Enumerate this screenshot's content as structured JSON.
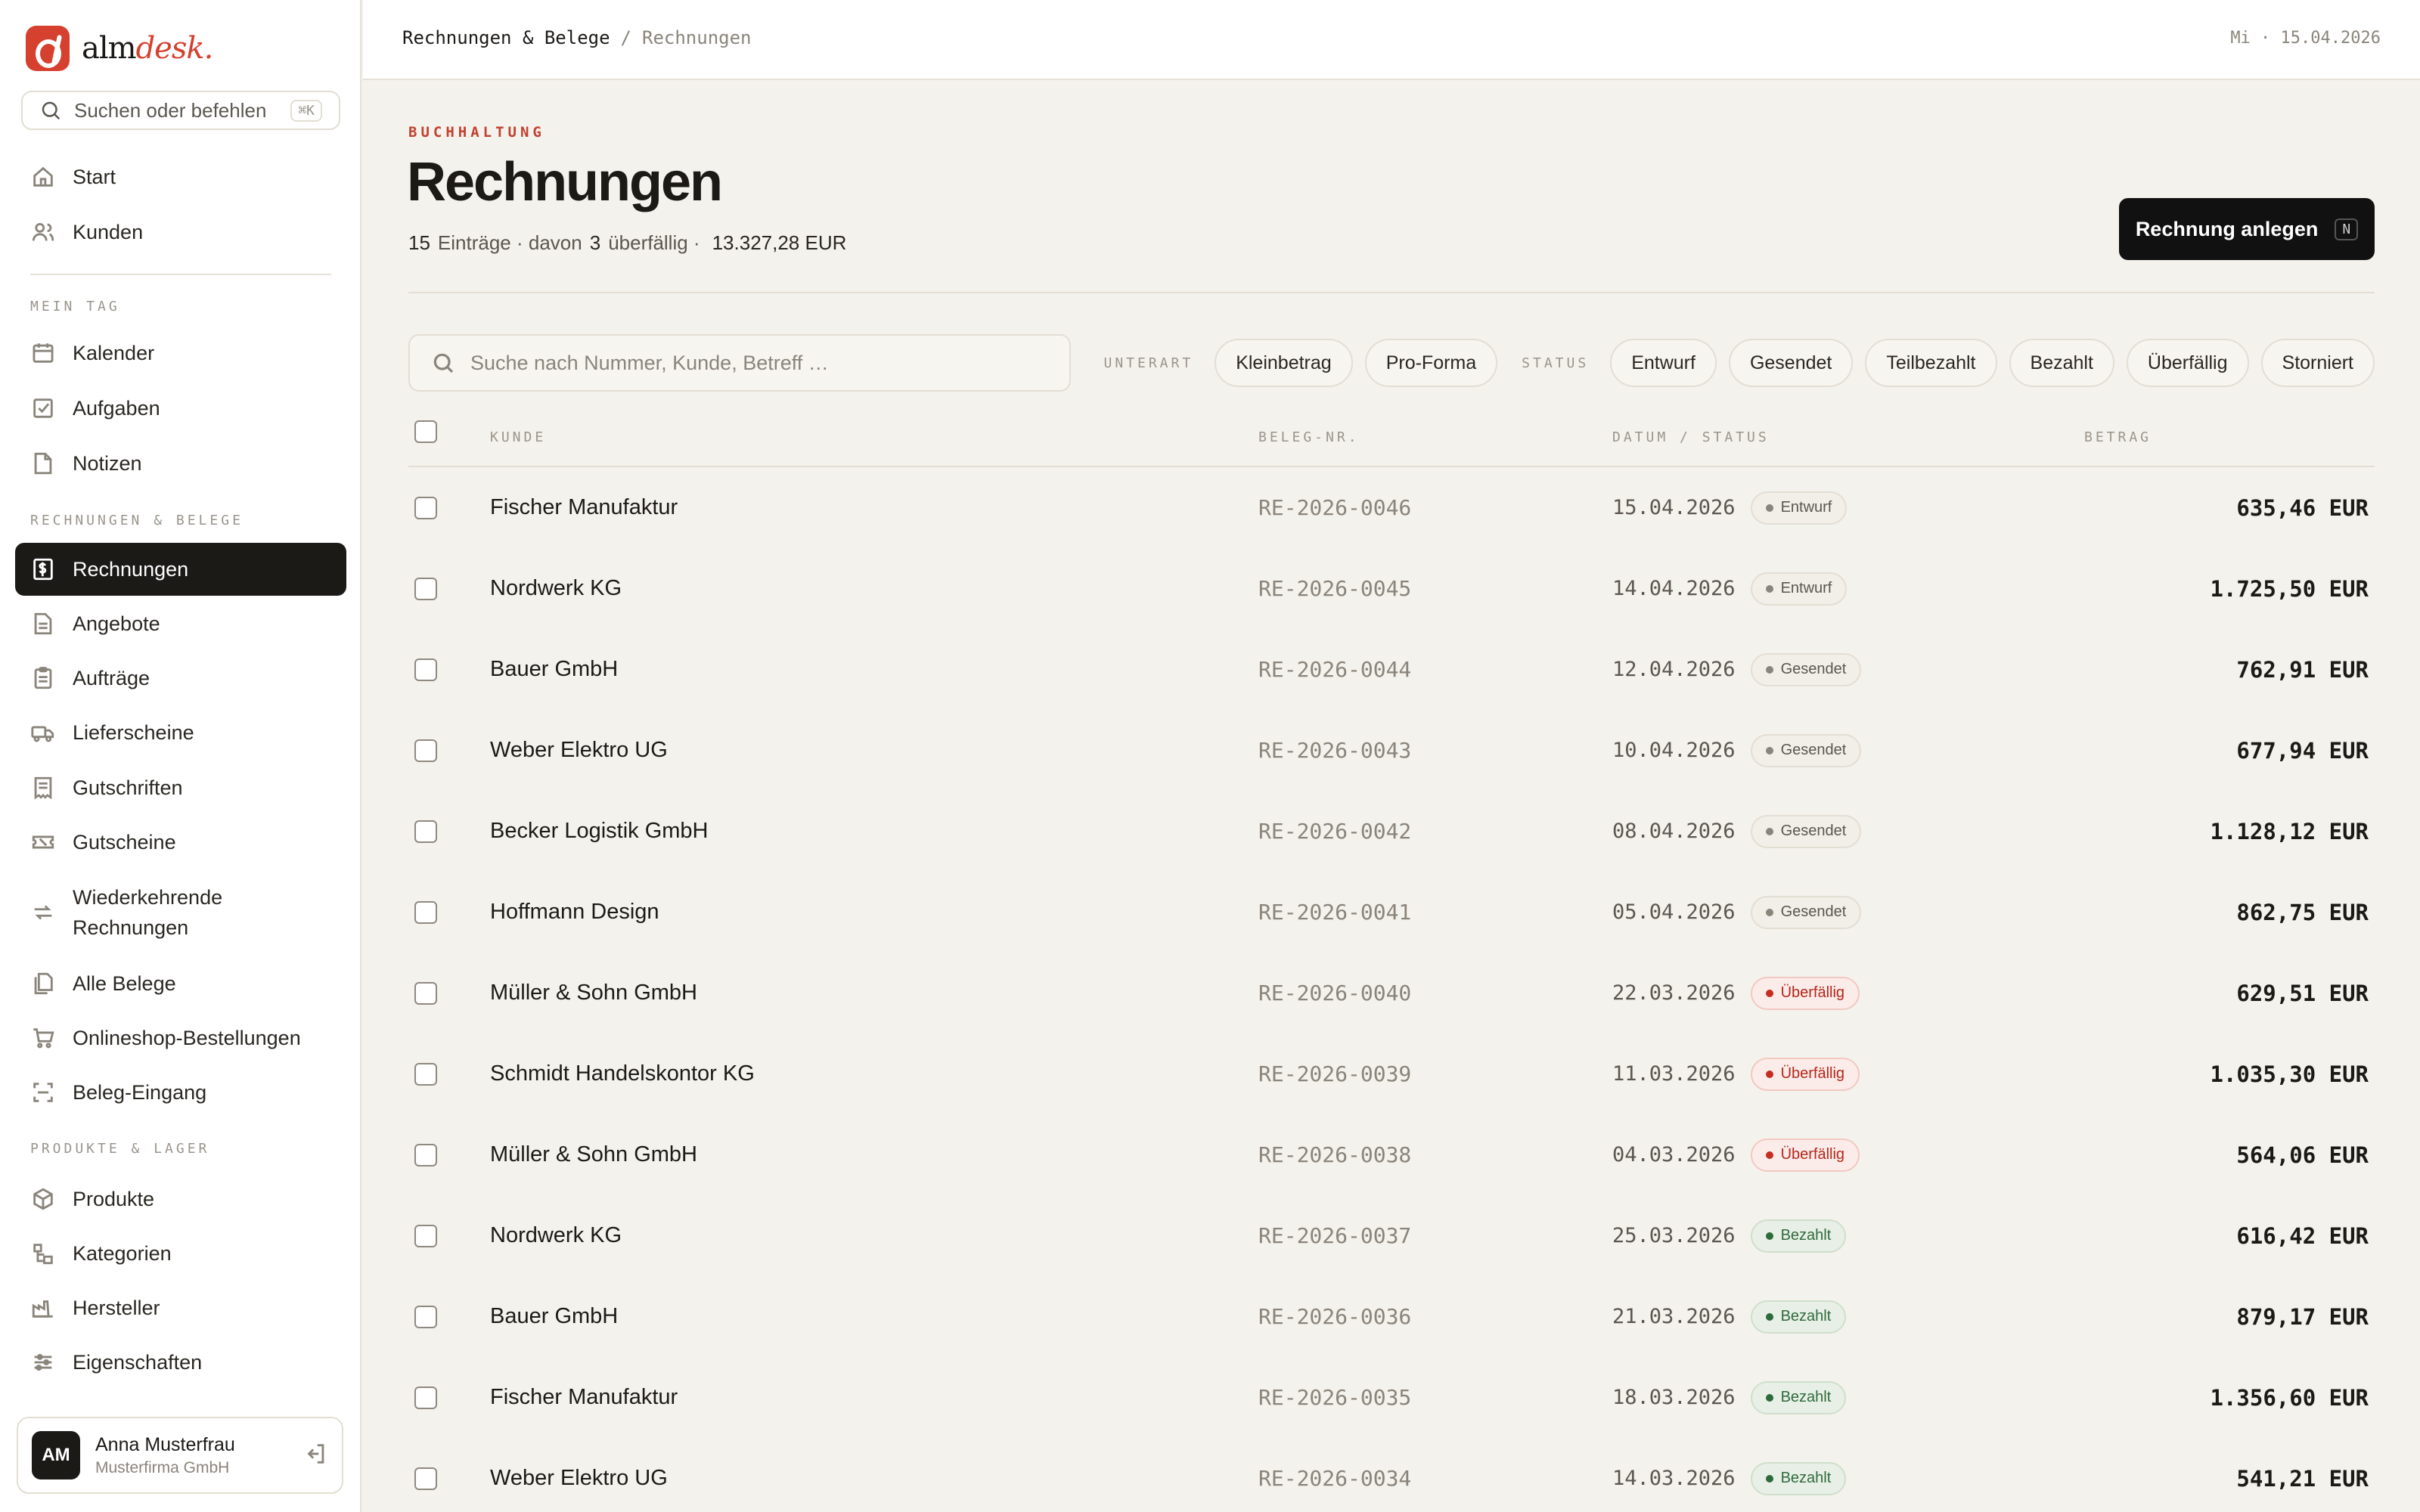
{
  "app": {
    "logo_main": "alm",
    "logo_accent": "desk."
  },
  "sidebar": {
    "search_placeholder": "Suchen oder befehlen",
    "search_shortcut": "⌘K",
    "top_items": [
      {
        "label": "Start",
        "icon": "home-icon"
      },
      {
        "label": "Kunden",
        "icon": "users-icon"
      }
    ],
    "sections": {
      "mein_tag": "MEIN TAG",
      "rechnungen": "RECHNUNGEN & BELEGE",
      "produkte": "PRODUKTE & LAGER"
    },
    "mein_tag_items": [
      {
        "label": "Kalender",
        "icon": "calendar-icon"
      },
      {
        "label": "Aufgaben",
        "icon": "checkbox-icon"
      },
      {
        "label": "Notizen",
        "icon": "note-icon"
      }
    ],
    "rechnungen_items": [
      {
        "label": "Rechnungen",
        "icon": "invoice-icon",
        "active": true
      },
      {
        "label": "Angebote",
        "icon": "document-icon"
      },
      {
        "label": "Aufträge",
        "icon": "clipboard-icon"
      },
      {
        "label": "Lieferscheine",
        "icon": "truck-icon"
      },
      {
        "label": "Gutschriften",
        "icon": "receipt-icon"
      },
      {
        "label": "Gutscheine",
        "icon": "ticket-icon"
      },
      {
        "label": "Wiederkehrende Rechnungen",
        "icon": "repeat-icon"
      },
      {
        "label": "Alle Belege",
        "icon": "files-icon"
      },
      {
        "label": "Onlineshop-Bestellungen",
        "icon": "cart-icon"
      },
      {
        "label": "Beleg-Eingang",
        "icon": "scan-icon"
      }
    ],
    "produkte_items": [
      {
        "label": "Produkte",
        "icon": "box-icon"
      },
      {
        "label": "Kategorien",
        "icon": "category-icon"
      },
      {
        "label": "Hersteller",
        "icon": "factory-icon"
      },
      {
        "label": "Eigenschaften",
        "icon": "sliders-icon"
      }
    ],
    "user": {
      "initials": "AM",
      "name": "Anna Musterfrau",
      "company": "Musterfirma GmbH"
    }
  },
  "topbar": {
    "breadcrumb_parent": "Rechnungen & Belege",
    "breadcrumb_sep": "/",
    "breadcrumb_current": "Rechnungen",
    "date": "Mi · 15.04.2026"
  },
  "page": {
    "eyebrow": "BUCHHALTUNG",
    "title": "Rechnungen",
    "summary": {
      "count": "15",
      "count_label": "Einträge · davon",
      "overdue": "3",
      "overdue_label": "überfällig ·",
      "total": "13.327,28 EUR"
    },
    "create_button": "Rechnung anlegen",
    "create_shortcut": "N"
  },
  "filters": {
    "search_placeholder": "Suche nach Nummer, Kunde, Betreff …",
    "unterart_label": "UNTERART",
    "unterart": [
      "Kleinbetrag",
      "Pro-Forma"
    ],
    "status_label": "STATUS",
    "status": [
      "Entwurf",
      "Gesendet",
      "Teilbezahlt",
      "Bezahlt",
      "Überfällig",
      "Storniert"
    ]
  },
  "table": {
    "columns": {
      "kunde": "KUNDE",
      "beleg": "BELEG-NR.",
      "datum": "DATUM / STATUS",
      "betrag": "BETRAG"
    },
    "rows": [
      {
        "kunde": "Fischer Manufaktur",
        "nr": "RE-2026-0046",
        "datum": "15.04.2026",
        "status": "Entwurf",
        "kind": "draft",
        "betrag": "635,46 EUR"
      },
      {
        "kunde": "Nordwerk KG",
        "nr": "RE-2026-0045",
        "datum": "14.04.2026",
        "status": "Entwurf",
        "kind": "draft",
        "betrag": "1.725,50 EUR"
      },
      {
        "kunde": "Bauer GmbH",
        "nr": "RE-2026-0044",
        "datum": "12.04.2026",
        "status": "Gesendet",
        "kind": "sent",
        "betrag": "762,91 EUR"
      },
      {
        "kunde": "Weber Elektro UG",
        "nr": "RE-2026-0043",
        "datum": "10.04.2026",
        "status": "Gesendet",
        "kind": "sent",
        "betrag": "677,94 EUR"
      },
      {
        "kunde": "Becker Logistik GmbH",
        "nr": "RE-2026-0042",
        "datum": "08.04.2026",
        "status": "Gesendet",
        "kind": "sent",
        "betrag": "1.128,12 EUR"
      },
      {
        "kunde": "Hoffmann Design",
        "nr": "RE-2026-0041",
        "datum": "05.04.2026",
        "status": "Gesendet",
        "kind": "sent",
        "betrag": "862,75 EUR"
      },
      {
        "kunde": "Müller & Sohn GmbH",
        "nr": "RE-2026-0040",
        "datum": "22.03.2026",
        "status": "Überfällig",
        "kind": "overdue",
        "betrag": "629,51 EUR"
      },
      {
        "kunde": "Schmidt Handelskontor KG",
        "nr": "RE-2026-0039",
        "datum": "11.03.2026",
        "status": "Überfällig",
        "kind": "overdue",
        "betrag": "1.035,30 EUR"
      },
      {
        "kunde": "Müller & Sohn GmbH",
        "nr": "RE-2026-0038",
        "datum": "04.03.2026",
        "status": "Überfällig",
        "kind": "overdue",
        "betrag": "564,06 EUR"
      },
      {
        "kunde": "Nordwerk KG",
        "nr": "RE-2026-0037",
        "datum": "25.03.2026",
        "status": "Bezahlt",
        "kind": "paid",
        "betrag": "616,42 EUR"
      },
      {
        "kunde": "Bauer GmbH",
        "nr": "RE-2026-0036",
        "datum": "21.03.2026",
        "status": "Bezahlt",
        "kind": "paid",
        "betrag": "879,17 EUR"
      },
      {
        "kunde": "Fischer Manufaktur",
        "nr": "RE-2026-0035",
        "datum": "18.03.2026",
        "status": "Bezahlt",
        "kind": "paid",
        "betrag": "1.356,60 EUR"
      },
      {
        "kunde": "Weber Elektro UG",
        "nr": "RE-2026-0034",
        "datum": "14.03.2026",
        "status": "Bezahlt",
        "kind": "paid",
        "betrag": "541,21 EUR"
      }
    ]
  },
  "colors": {
    "accent": "#d6402e",
    "overdue": "#b5261a",
    "paid": "#2e6b3c",
    "dark": "#1c1a17"
  }
}
